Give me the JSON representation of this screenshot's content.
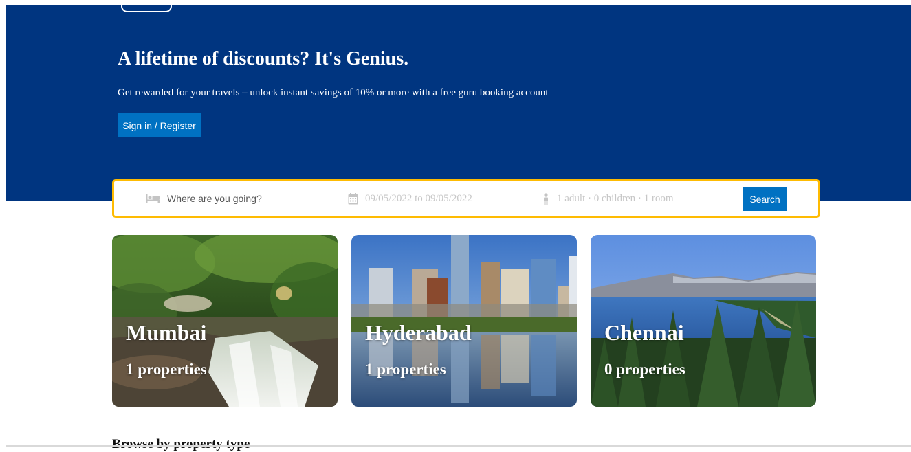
{
  "hero": {
    "title": "A lifetime of discounts? It's Genius.",
    "subtitle": "Get rewarded for your travels – unlock instant savings of 10% or more with a free guru booking account",
    "signin_label": "Sign in / Register"
  },
  "search": {
    "destination_placeholder": "Where are you going?",
    "dates": "09/05/2022 to 09/05/2022",
    "guests": "1 adult · 0 children · 1 room",
    "button_label": "Search"
  },
  "featured": [
    {
      "city": "Mumbai",
      "count": "1 properties"
    },
    {
      "city": "Hyderabad",
      "count": "1 properties"
    },
    {
      "city": "Chennai",
      "count": "0 properties"
    }
  ],
  "browse": {
    "heading": "Browse by property type"
  },
  "colors": {
    "hero_bg": "#003580",
    "primary_button": "#0071c2",
    "search_border": "#febb02"
  },
  "icons": {
    "destination": "bed-icon",
    "dates": "calendar-icon",
    "guests": "person-icon"
  }
}
